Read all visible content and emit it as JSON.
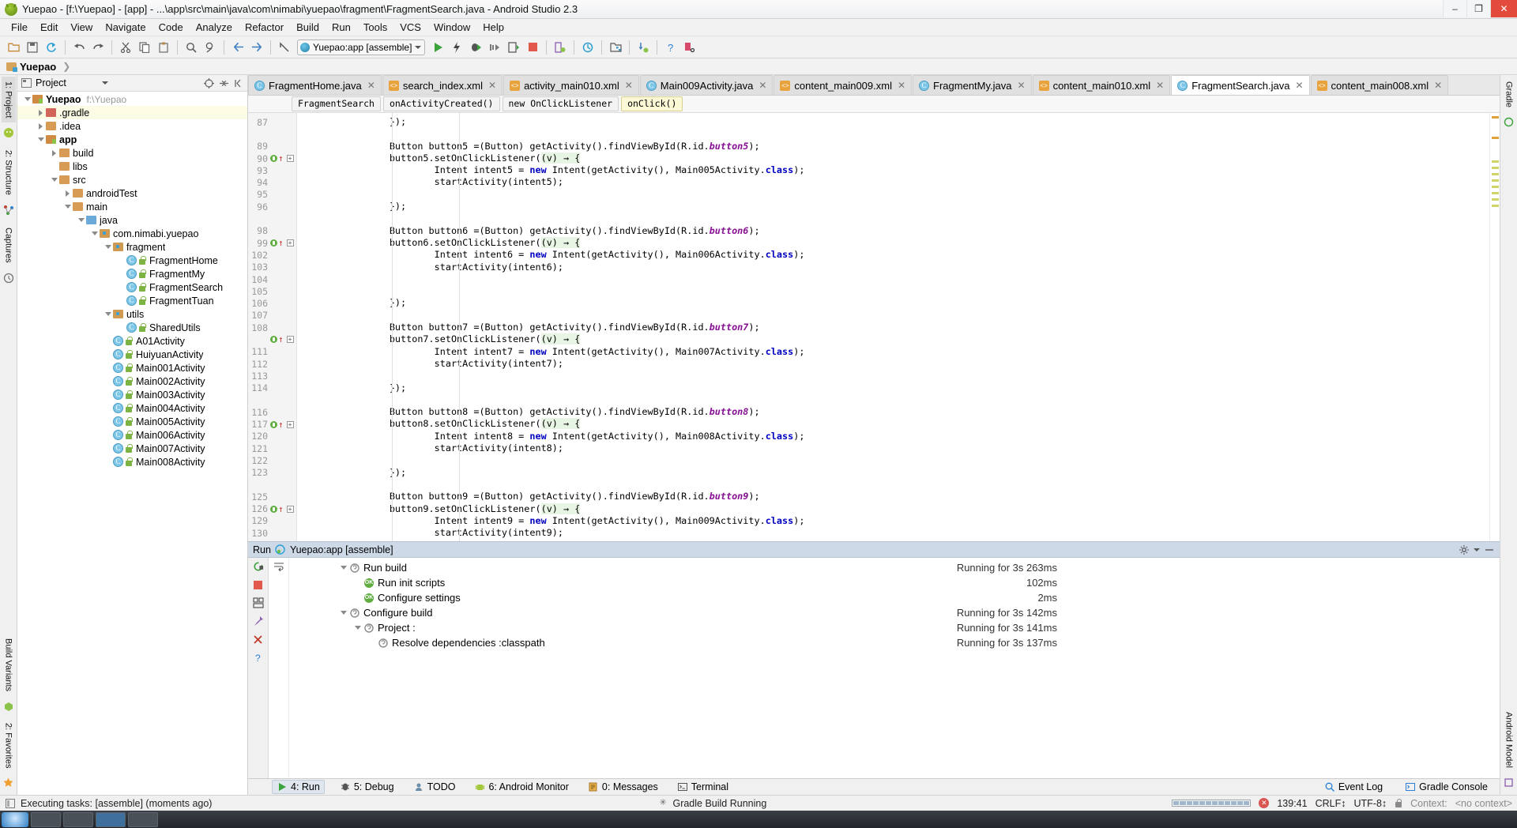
{
  "window": {
    "title": "Yuepao - [f:\\Yuepao] - [app] - ...\\app\\src\\main\\java\\com\\nimabi\\yuepao\\fragment\\FragmentSearch.java - Android Studio 2.3",
    "minimize": "–",
    "maximize": "❐",
    "close": "✕"
  },
  "menu": [
    "File",
    "Edit",
    "View",
    "Navigate",
    "Code",
    "Analyze",
    "Refactor",
    "Build",
    "Run",
    "Tools",
    "VCS",
    "Window",
    "Help"
  ],
  "toolbar": {
    "run_config": "Yuepao:app [assemble]"
  },
  "navbar": {
    "project_crumb": "Yuepao"
  },
  "left_strip": {
    "project_tab": "1: Project",
    "structure_tab": "2: Structure",
    "captures_tab": "Captures",
    "build_variants_tab": "Build Variants",
    "favorites_tab": "2: Favorites"
  },
  "right_strip": {
    "gradle_tab": "Gradle",
    "android_model_tab": "Android Model"
  },
  "project_panel": {
    "selector_label": "Project",
    "tree": [
      {
        "depth": 0,
        "arrow": "down",
        "icon": "module",
        "label": "Yuepao",
        "bold": true,
        "path": "f:\\Yuepao",
        "selected": false
      },
      {
        "depth": 1,
        "arrow": "right",
        "icon": "folder-red",
        "label": ".gradle",
        "bold": false,
        "path": "",
        "selected": true
      },
      {
        "depth": 1,
        "arrow": "right",
        "icon": "folder",
        "label": ".idea",
        "bold": false,
        "path": "",
        "selected": false
      },
      {
        "depth": 1,
        "arrow": "down",
        "icon": "module",
        "label": "app",
        "bold": true,
        "path": "",
        "selected": false
      },
      {
        "depth": 2,
        "arrow": "right",
        "icon": "folder",
        "label": "build",
        "bold": false,
        "path": "",
        "selected": false
      },
      {
        "depth": 2,
        "arrow": "none",
        "icon": "folder",
        "label": "libs",
        "bold": false,
        "path": "",
        "selected": false
      },
      {
        "depth": 2,
        "arrow": "down",
        "icon": "folder",
        "label": "src",
        "bold": false,
        "path": "",
        "selected": false
      },
      {
        "depth": 3,
        "arrow": "right",
        "icon": "folder",
        "label": "androidTest",
        "bold": false,
        "path": "",
        "selected": false
      },
      {
        "depth": 3,
        "arrow": "down",
        "icon": "folder",
        "label": "main",
        "bold": false,
        "path": "",
        "selected": false
      },
      {
        "depth": 4,
        "arrow": "down",
        "icon": "folder-blue",
        "label": "java",
        "bold": false,
        "path": "",
        "selected": false
      },
      {
        "depth": 5,
        "arrow": "down",
        "icon": "package",
        "label": "com.nimabi.yuepao",
        "bold": false,
        "path": "",
        "selected": false
      },
      {
        "depth": 6,
        "arrow": "down",
        "icon": "package",
        "label": "fragment",
        "bold": false,
        "path": "",
        "selected": false
      },
      {
        "depth": 7,
        "arrow": "none",
        "icon": "class",
        "label": "FragmentHome",
        "bold": false,
        "path": "",
        "selected": false
      },
      {
        "depth": 7,
        "arrow": "none",
        "icon": "class",
        "label": "FragmentMy",
        "bold": false,
        "path": "",
        "selected": false
      },
      {
        "depth": 7,
        "arrow": "none",
        "icon": "class",
        "label": "FragmentSearch",
        "bold": false,
        "path": "",
        "selected": false
      },
      {
        "depth": 7,
        "arrow": "none",
        "icon": "class",
        "label": "FragmentTuan",
        "bold": false,
        "path": "",
        "selected": false
      },
      {
        "depth": 6,
        "arrow": "down",
        "icon": "package",
        "label": "utils",
        "bold": false,
        "path": "",
        "selected": false
      },
      {
        "depth": 7,
        "arrow": "none",
        "icon": "class",
        "label": "SharedUtils",
        "bold": false,
        "path": "",
        "selected": false
      },
      {
        "depth": 6,
        "arrow": "none",
        "icon": "class",
        "label": "A01Activity",
        "bold": false,
        "path": "",
        "selected": false
      },
      {
        "depth": 6,
        "arrow": "none",
        "icon": "class",
        "label": "HuiyuanActivity",
        "bold": false,
        "path": "",
        "selected": false
      },
      {
        "depth": 6,
        "arrow": "none",
        "icon": "class",
        "label": "Main001Activity",
        "bold": false,
        "path": "",
        "selected": false
      },
      {
        "depth": 6,
        "arrow": "none",
        "icon": "class",
        "label": "Main002Activity",
        "bold": false,
        "path": "",
        "selected": false
      },
      {
        "depth": 6,
        "arrow": "none",
        "icon": "class",
        "label": "Main003Activity",
        "bold": false,
        "path": "",
        "selected": false
      },
      {
        "depth": 6,
        "arrow": "none",
        "icon": "class",
        "label": "Main004Activity",
        "bold": false,
        "path": "",
        "selected": false
      },
      {
        "depth": 6,
        "arrow": "none",
        "icon": "class",
        "label": "Main005Activity",
        "bold": false,
        "path": "",
        "selected": false
      },
      {
        "depth": 6,
        "arrow": "none",
        "icon": "class",
        "label": "Main006Activity",
        "bold": false,
        "path": "",
        "selected": false
      },
      {
        "depth": 6,
        "arrow": "none",
        "icon": "class",
        "label": "Main007Activity",
        "bold": false,
        "path": "",
        "selected": false
      },
      {
        "depth": 6,
        "arrow": "none",
        "icon": "class",
        "label": "Main008Activity",
        "bold": false,
        "path": "",
        "selected": false
      }
    ]
  },
  "editor": {
    "tabs": [
      {
        "label": "FragmentHome.java",
        "type": "java",
        "active": false
      },
      {
        "label": "search_index.xml",
        "type": "xml",
        "active": false
      },
      {
        "label": "activity_main010.xml",
        "type": "xml",
        "active": false
      },
      {
        "label": "Main009Activity.java",
        "type": "java",
        "active": false
      },
      {
        "label": "content_main009.xml",
        "type": "xml",
        "active": false
      },
      {
        "label": "FragmentMy.java",
        "type": "java",
        "active": false
      },
      {
        "label": "content_main010.xml",
        "type": "xml",
        "active": false
      },
      {
        "label": "FragmentSearch.java",
        "type": "java",
        "active": true
      },
      {
        "label": "content_main008.xml",
        "type": "xml",
        "active": false
      }
    ],
    "breadcrumbs": [
      {
        "label": "FragmentSearch",
        "highlight": false
      },
      {
        "label": "onActivityCreated()",
        "highlight": false
      },
      {
        "label": "new OnClickListener",
        "highlight": false
      },
      {
        "label": "onClick()",
        "highlight": true
      }
    ],
    "lines": [
      {
        "num": "87",
        "bp": false,
        "fold": false,
        "segments": [
          {
            "t": "        });",
            "c": ""
          }
        ]
      },
      {
        "num": "",
        "bp": false,
        "fold": false,
        "segments": [
          {
            "t": "",
            "c": ""
          }
        ]
      },
      {
        "num": "89",
        "bp": false,
        "fold": false,
        "segments": [
          {
            "t": "        Button button5 =(Button) getActivity().findViewById(R.id.",
            "c": ""
          },
          {
            "t": "button5",
            "c": "fld"
          },
          {
            "t": ");",
            "c": ""
          }
        ]
      },
      {
        "num": "90",
        "bp": true,
        "fold": true,
        "segments": [
          {
            "t": "        button5.setOnClickListener(",
            "c": ""
          },
          {
            "t": "(v) → {",
            "c": "lamb"
          }
        ]
      },
      {
        "num": "93",
        "bp": false,
        "fold": false,
        "segments": [
          {
            "t": "                Intent intent5 = ",
            "c": ""
          },
          {
            "t": "new",
            "c": "kw"
          },
          {
            "t": " Intent(getActivity(), Main005Activity.",
            "c": ""
          },
          {
            "t": "class",
            "c": "kw"
          },
          {
            "t": ");",
            "c": ""
          }
        ]
      },
      {
        "num": "94",
        "bp": false,
        "fold": false,
        "segments": [
          {
            "t": "                startActivity(intent5);",
            "c": ""
          }
        ]
      },
      {
        "num": "95",
        "bp": false,
        "fold": false,
        "segments": [
          {
            "t": "",
            "c": ""
          }
        ]
      },
      {
        "num": "96",
        "bp": false,
        "fold": false,
        "segments": [
          {
            "t": "        });",
            "c": ""
          }
        ]
      },
      {
        "num": "",
        "bp": false,
        "fold": false,
        "segments": [
          {
            "t": "",
            "c": ""
          }
        ]
      },
      {
        "num": "98",
        "bp": false,
        "fold": false,
        "segments": [
          {
            "t": "        Button button6 =(Button) getActivity().findViewById(R.id.",
            "c": ""
          },
          {
            "t": "button6",
            "c": "fld"
          },
          {
            "t": ");",
            "c": ""
          }
        ]
      },
      {
        "num": "99",
        "bp": true,
        "fold": true,
        "segments": [
          {
            "t": "        button6.setOnClickListener(",
            "c": ""
          },
          {
            "t": "(v) → {",
            "c": "lamb"
          }
        ]
      },
      {
        "num": "102",
        "bp": false,
        "fold": false,
        "segments": [
          {
            "t": "                Intent intent6 = ",
            "c": ""
          },
          {
            "t": "new",
            "c": "kw"
          },
          {
            "t": " Intent(getActivity(), Main006Activity.",
            "c": ""
          },
          {
            "t": "class",
            "c": "kw"
          },
          {
            "t": ");",
            "c": ""
          }
        ]
      },
      {
        "num": "103",
        "bp": false,
        "fold": false,
        "segments": [
          {
            "t": "                startActivity(intent6);",
            "c": ""
          }
        ]
      },
      {
        "num": "104",
        "bp": false,
        "fold": false,
        "segments": [
          {
            "t": "",
            "c": ""
          }
        ]
      },
      {
        "num": "105",
        "bp": false,
        "fold": false,
        "segments": [
          {
            "t": "",
            "c": ""
          }
        ]
      },
      {
        "num": "106",
        "bp": false,
        "fold": false,
        "segments": [
          {
            "t": "        });",
            "c": ""
          }
        ]
      },
      {
        "num": "107",
        "bp": false,
        "fold": false,
        "segments": [
          {
            "t": "",
            "c": ""
          }
        ]
      },
      {
        "num": "108",
        "bp": false,
        "fold": false,
        "segments": [
          {
            "t": "        Button button7 =(Button) getActivity().findViewById(R.id.",
            "c": ""
          },
          {
            "t": "button7",
            "c": "fld"
          },
          {
            "t": ");",
            "c": ""
          }
        ]
      },
      {
        "num": "",
        "bp": true,
        "fold": true,
        "segments": [
          {
            "t": "        button7.setOnClickListener(",
            "c": ""
          },
          {
            "t": "(v) → {",
            "c": "lamb"
          }
        ]
      },
      {
        "num": "111",
        "bp": false,
        "fold": false,
        "segments": [
          {
            "t": "                Intent intent7 = ",
            "c": ""
          },
          {
            "t": "new",
            "c": "kw"
          },
          {
            "t": " Intent(getActivity(), Main007Activity.",
            "c": ""
          },
          {
            "t": "class",
            "c": "kw"
          },
          {
            "t": ");",
            "c": ""
          }
        ]
      },
      {
        "num": "112",
        "bp": false,
        "fold": false,
        "segments": [
          {
            "t": "                startActivity(intent7);",
            "c": ""
          }
        ]
      },
      {
        "num": "113",
        "bp": false,
        "fold": false,
        "segments": [
          {
            "t": "",
            "c": ""
          }
        ]
      },
      {
        "num": "114",
        "bp": false,
        "fold": false,
        "segments": [
          {
            "t": "        });",
            "c": ""
          }
        ]
      },
      {
        "num": "",
        "bp": false,
        "fold": false,
        "segments": [
          {
            "t": "",
            "c": ""
          }
        ]
      },
      {
        "num": "116",
        "bp": false,
        "fold": false,
        "segments": [
          {
            "t": "        Button button8 =(Button) getActivity().findViewById(R.id.",
            "c": ""
          },
          {
            "t": "button8",
            "c": "fld"
          },
          {
            "t": ");",
            "c": ""
          }
        ]
      },
      {
        "num": "117",
        "bp": true,
        "fold": true,
        "segments": [
          {
            "t": "        button8.setOnClickListener(",
            "c": ""
          },
          {
            "t": "(v) → {",
            "c": "lamb"
          }
        ]
      },
      {
        "num": "120",
        "bp": false,
        "fold": false,
        "segments": [
          {
            "t": "                Intent intent8 = ",
            "c": ""
          },
          {
            "t": "new",
            "c": "kw"
          },
          {
            "t": " Intent(getActivity(), Main008Activity.",
            "c": ""
          },
          {
            "t": "class",
            "c": "kw"
          },
          {
            "t": ");",
            "c": ""
          }
        ]
      },
      {
        "num": "121",
        "bp": false,
        "fold": false,
        "segments": [
          {
            "t": "                startActivity(intent8);",
            "c": ""
          }
        ]
      },
      {
        "num": "122",
        "bp": false,
        "fold": false,
        "segments": [
          {
            "t": "",
            "c": ""
          }
        ]
      },
      {
        "num": "123",
        "bp": false,
        "fold": false,
        "segments": [
          {
            "t": "        });",
            "c": ""
          }
        ]
      },
      {
        "num": "",
        "bp": false,
        "fold": false,
        "segments": [
          {
            "t": "",
            "c": ""
          }
        ]
      },
      {
        "num": "125",
        "bp": false,
        "fold": false,
        "segments": [
          {
            "t": "        Button button9 =(Button) getActivity().findViewById(R.id.",
            "c": ""
          },
          {
            "t": "button9",
            "c": "fld"
          },
          {
            "t": ");",
            "c": ""
          }
        ]
      },
      {
        "num": "126",
        "bp": true,
        "fold": true,
        "segments": [
          {
            "t": "        button9.setOnClickListener(",
            "c": ""
          },
          {
            "t": "(v) → {",
            "c": "lamb"
          }
        ]
      },
      {
        "num": "129",
        "bp": false,
        "fold": false,
        "segments": [
          {
            "t": "                Intent intent9 = ",
            "c": ""
          },
          {
            "t": "new",
            "c": "kw"
          },
          {
            "t": " Intent(getActivity(), Main009Activity.",
            "c": ""
          },
          {
            "t": "class",
            "c": "kw"
          },
          {
            "t": ");",
            "c": ""
          }
        ]
      },
      {
        "num": "130",
        "bp": false,
        "fold": false,
        "segments": [
          {
            "t": "                startActivity(intent9);",
            "c": ""
          }
        ]
      }
    ]
  },
  "run_window": {
    "title": "Run",
    "config": "Yuepao:app [assemble]",
    "rows": [
      {
        "depth": 0,
        "arrow": "down",
        "icon": "task",
        "label": "Run build",
        "time": "Running for 3s 263ms"
      },
      {
        "depth": 1,
        "arrow": "none",
        "icon": "ok",
        "label": "Run init scripts",
        "time": "102ms"
      },
      {
        "depth": 1,
        "arrow": "none",
        "icon": "ok",
        "label": "Configure settings",
        "time": "2ms"
      },
      {
        "depth": 0,
        "arrow": "down",
        "icon": "task",
        "label": "Configure build",
        "time": "Running for 3s 142ms"
      },
      {
        "depth": 1,
        "arrow": "down",
        "icon": "task",
        "label": "Project :",
        "time": "Running for 3s 141ms"
      },
      {
        "depth": 2,
        "arrow": "none",
        "icon": "task",
        "label": "Resolve dependencies :classpath",
        "time": "Running for 3s 137ms"
      }
    ]
  },
  "bottom_tabs": [
    {
      "label": "4: Run",
      "icon": "run-icon",
      "active": true
    },
    {
      "label": "5: Debug",
      "icon": "debug-icon",
      "active": false
    },
    {
      "label": "TODO",
      "icon": "todo-icon",
      "active": false
    },
    {
      "label": "6: Android Monitor",
      "icon": "android-icon",
      "active": false
    },
    {
      "label": "0: Messages",
      "icon": "messages-icon",
      "active": false
    },
    {
      "label": "Terminal",
      "icon": "terminal-icon",
      "active": false
    }
  ],
  "bottom_right": [
    {
      "label": "Event Log",
      "icon": "event-log-icon"
    },
    {
      "label": "Gradle Console",
      "icon": "gradle-console-icon"
    }
  ],
  "statusbar": {
    "message": "Executing tasks: [assemble] (moments ago)",
    "gradle_status": "Gradle Build Running",
    "caret": "139:41",
    "line_sep": "CRLF↕",
    "encoding": "UTF-8↕",
    "context_label": "Context:",
    "context_value": "<no context>"
  },
  "colors": {
    "accent": "#3f9fd1",
    "keyword": "#0000c0",
    "field": "#871094",
    "selection": "#fcfbe3",
    "breakpoint": "#5fae3f",
    "error": "#d9534f",
    "run_header": "#cdd9e7"
  }
}
